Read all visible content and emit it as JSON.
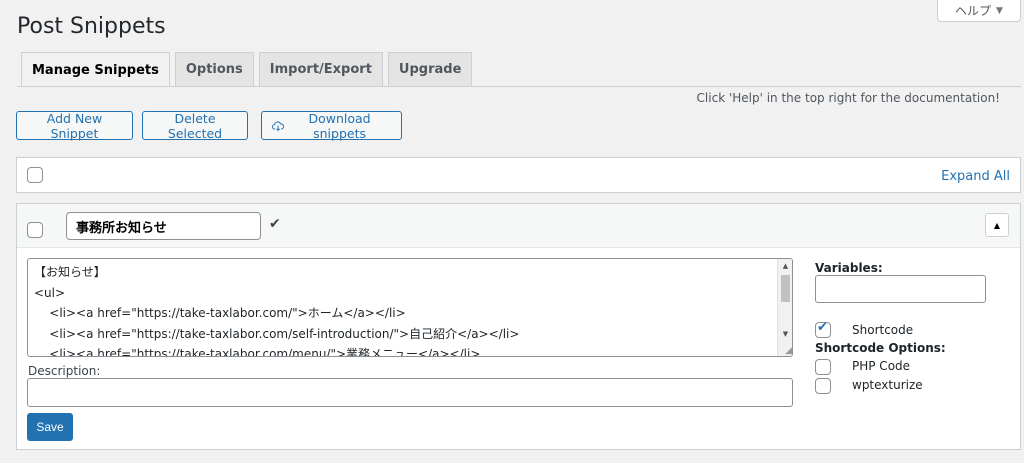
{
  "help_tab": {
    "label": "ヘルプ",
    "arrow": "▼"
  },
  "page_title": "Post Snippets",
  "tabs": [
    {
      "label": "Manage Snippets",
      "active": true
    },
    {
      "label": "Options",
      "active": false
    },
    {
      "label": "Import/Export",
      "active": false
    },
    {
      "label": "Upgrade",
      "active": false
    }
  ],
  "help_note": "Click 'Help' in the top right for the documentation!",
  "actions": {
    "add_new": "Add New Snippet",
    "delete_selected": "Delete Selected",
    "download": "Download snippets"
  },
  "bulk_bar": {
    "expand_all": "Expand All"
  },
  "snippet": {
    "title": "事務所お知らせ",
    "code_lines": [
      "【お知らせ】",
      "<ul>",
      "\t<li><a href=\"https://take-taxlabor.com/\">ホーム</a></li>",
      "\t<li><a href=\"https://take-taxlabor.com/self-introduction/\">自己紹介</a></li>",
      "\t<li><a href=\"https://take-taxlabor.com/menu/\">業務メニュー</a></li>"
    ],
    "description_label": "Description:",
    "description_value": "",
    "save_label": "Save",
    "variables_label": "Variables:",
    "variables_value": "",
    "shortcode": {
      "label": "Shortcode",
      "checked": true
    },
    "shortcode_options_label": "Shortcode Options:",
    "php_code": {
      "label": "PHP Code",
      "checked": false
    },
    "wptexturize": {
      "label": "wptexturize",
      "checked": false
    }
  },
  "colors": {
    "accent": "#2271b1",
    "background": "#f1f1f1"
  }
}
